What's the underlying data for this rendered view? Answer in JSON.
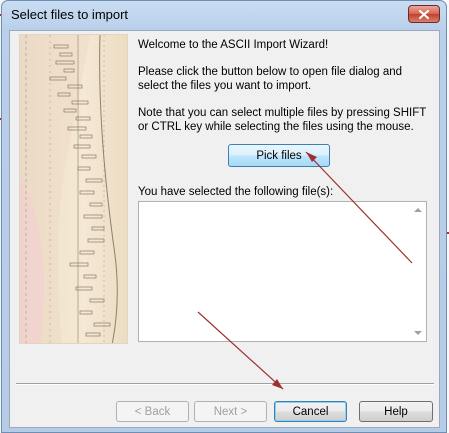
{
  "window": {
    "title": "Select files to import",
    "close_icon": "close-icon"
  },
  "wizard": {
    "welcome": "Welcome to the ASCII Import Wizard!",
    "instructions": "Please click the button below to open file dialog and select the files you want to import.",
    "note": "Note that you can select multiple files by pressing SHIFT or CTRL key while selecting the files using the mouse.",
    "pick_button": "Pick files",
    "selected_label": "You have selected the following file(s):",
    "selected_files": []
  },
  "footer": {
    "back": "< Back",
    "next": "Next >",
    "cancel": "Cancel",
    "help": "Help"
  },
  "colors": {
    "annotation_arrow": "#a03030",
    "title_bar": "#b9cfea",
    "close_button": "#c0402c"
  }
}
